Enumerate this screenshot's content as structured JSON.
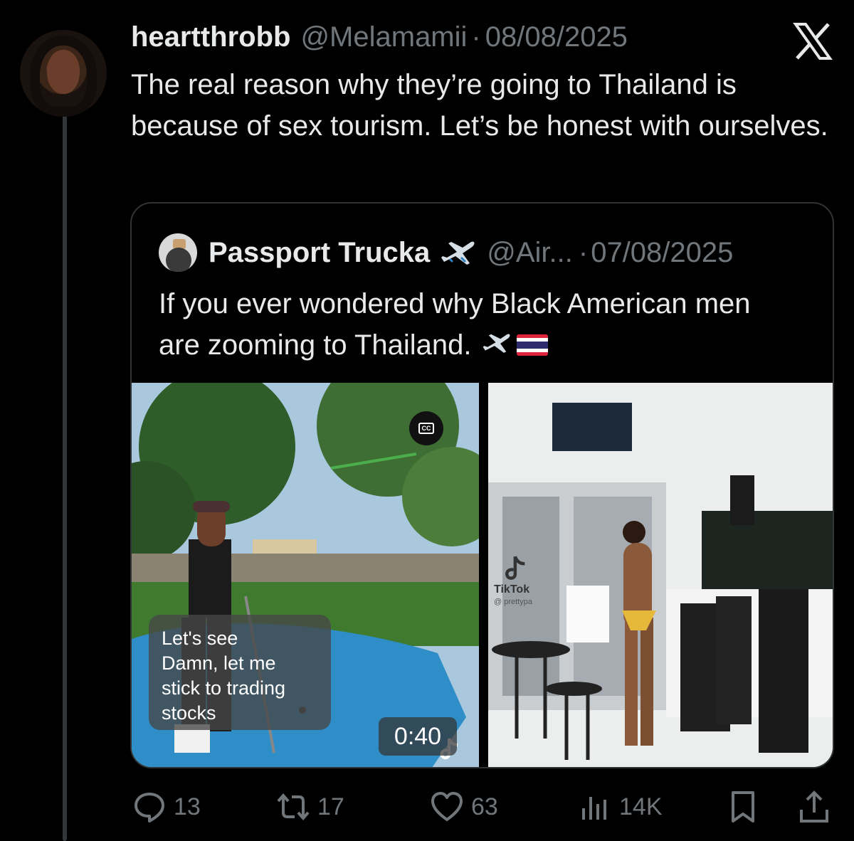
{
  "tweet": {
    "display_name": "heartthrobb",
    "handle": "@Melamamii",
    "separator": "·",
    "date": "08/08/2025",
    "text": "The real reason why they’re going to Thailand is because of sex tourism. Let’s be honest with ourselves."
  },
  "quoted": {
    "display_name": "Passport Trucka",
    "handle": "@Air...",
    "separator": "·",
    "date": "07/08/2025",
    "text": "If you ever wondered why Black American men are zooming to Thailand.",
    "emoji": [
      "airplane",
      "thailand-flag"
    ],
    "media": {
      "left_caption": [
        "Let's see",
        "Damn, let me stick to trading",
        "stocks"
      ],
      "cc_label": "CC",
      "tiktok_label": "TikTok",
      "tiktok_user": "@ prettypa",
      "duration": "0:40"
    }
  },
  "actions": {
    "replies": "13",
    "reposts": "17",
    "likes": "63",
    "views": "14K"
  },
  "colors": {
    "background": "#000000",
    "text": "#e7e9ea",
    "muted": "#71767b",
    "border": "#2f3336"
  }
}
